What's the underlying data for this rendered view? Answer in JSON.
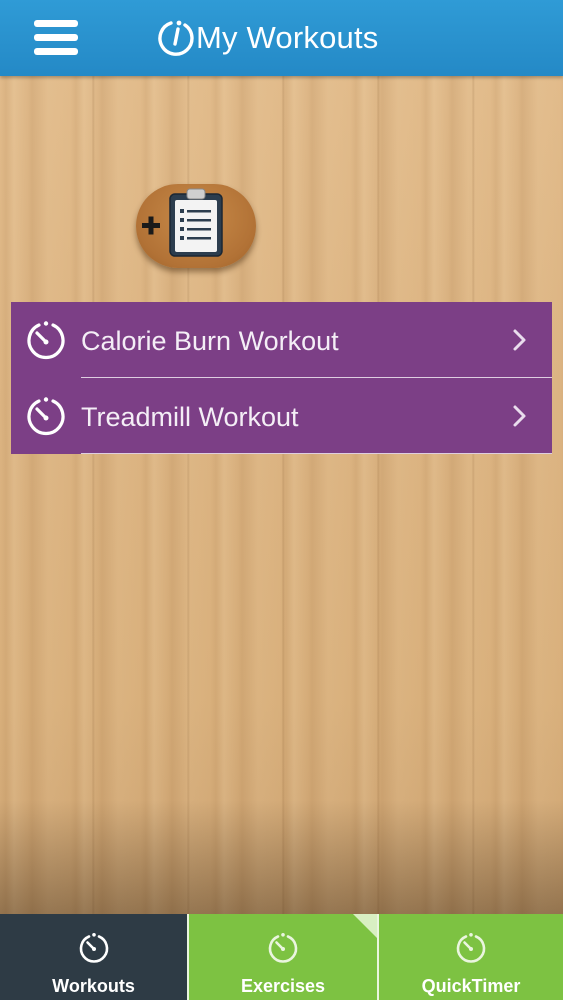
{
  "header": {
    "title": "My Workouts",
    "menu_icon": "hamburger-menu-icon",
    "logo_icon": "stopwatch-logo-icon",
    "background_color": "#2489c6"
  },
  "add_workout": {
    "icon": "add-clipboard-icon"
  },
  "workouts": [
    {
      "name": "Calorie Burn Workout",
      "icon": "stopwatch-icon"
    },
    {
      "name": "Treadmill Workout",
      "icon": "stopwatch-icon"
    }
  ],
  "list_color": "#7c3f86",
  "tabs": [
    {
      "label": "Workouts",
      "icon": "stopwatch-icon",
      "selected": true,
      "color": "#2e3b45"
    },
    {
      "label": "Exercises",
      "icon": "stopwatch-icon",
      "selected": false,
      "color": "#7dc242"
    },
    {
      "label": "QuickTimer",
      "icon": "stopwatch-icon",
      "selected": false,
      "color": "#7dc242"
    }
  ]
}
